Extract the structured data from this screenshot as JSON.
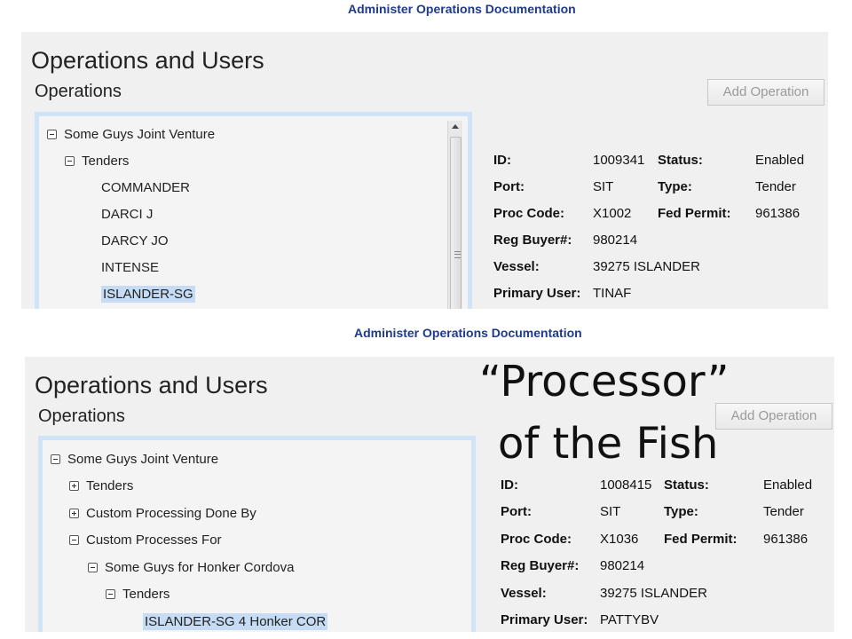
{
  "panel1": {
    "doc_title": "Administer Operations Documentation",
    "app_title": "Operations and Users",
    "section_title": "Operations",
    "add_button": "Add Operation",
    "tree": [
      {
        "label": "Some Guys Joint Venture",
        "toggle": "minus",
        "selected": false
      },
      {
        "label": "Tenders",
        "toggle": "minus",
        "selected": false
      },
      {
        "label": "COMMANDER",
        "toggle": "",
        "selected": false
      },
      {
        "label": "DARCI J",
        "toggle": "",
        "selected": false
      },
      {
        "label": "DARCY JO",
        "toggle": "",
        "selected": false
      },
      {
        "label": "INTENSE",
        "toggle": "",
        "selected": false
      },
      {
        "label": "ISLANDER-SG",
        "toggle": "",
        "selected": true
      }
    ],
    "details": {
      "id_label": "ID:",
      "id_value": "1009341",
      "status_label": "Status:",
      "status_value": "Enabled",
      "port_label": "Port:",
      "port_value": "SIT",
      "type_label": "Type:",
      "type_value": "Tender",
      "proc_label": "Proc Code:",
      "proc_value": "X1002",
      "fed_label": "Fed Permit:",
      "fed_value": "961386",
      "buyer_label": "Reg Buyer#:",
      "buyer_value": "980214",
      "vessel_label": "Vessel:",
      "vessel_value": "39275 ISLANDER",
      "user_label": "Primary User:",
      "user_value": "TINAF"
    }
  },
  "panel2": {
    "doc_title": "Administer Operations Documentation",
    "app_title": "Operations and Users",
    "section_title": "Operations",
    "add_button": "Add Operation",
    "tree": [
      {
        "label": "Some Guys Joint Venture",
        "toggle": "minus",
        "selected": false
      },
      {
        "label": "Tenders",
        "toggle": "plus",
        "selected": false
      },
      {
        "label": "Custom Processing Done By",
        "toggle": "plus",
        "selected": false
      },
      {
        "label": "Custom Processes For",
        "toggle": "minus",
        "selected": false
      },
      {
        "label": "Some Guys for Honker Cordova",
        "toggle": "minus",
        "selected": false
      },
      {
        "label": "Tenders",
        "toggle": "minus",
        "selected": false
      },
      {
        "label": "ISLANDER-SG 4 Honker COR",
        "toggle": "",
        "selected": true
      }
    ],
    "details": {
      "id_label": "ID:",
      "id_value": "1008415",
      "status_label": "Status:",
      "status_value": "Enabled",
      "port_label": "Port:",
      "port_value": "SIT",
      "type_label": "Type:",
      "type_value": "Tender",
      "proc_label": "Proc Code:",
      "proc_value": "X1036",
      "fed_label": "Fed Permit:",
      "fed_value": "961386",
      "buyer_label": "Reg Buyer#:",
      "buyer_value": "980214",
      "vessel_label": "Vessel:",
      "vessel_value": "39275 ISLANDER",
      "user_label": "Primary User:",
      "user_value": "PATTYBV"
    }
  },
  "annotation": {
    "line1": "“Processor”",
    "line2": "of the Fish"
  }
}
